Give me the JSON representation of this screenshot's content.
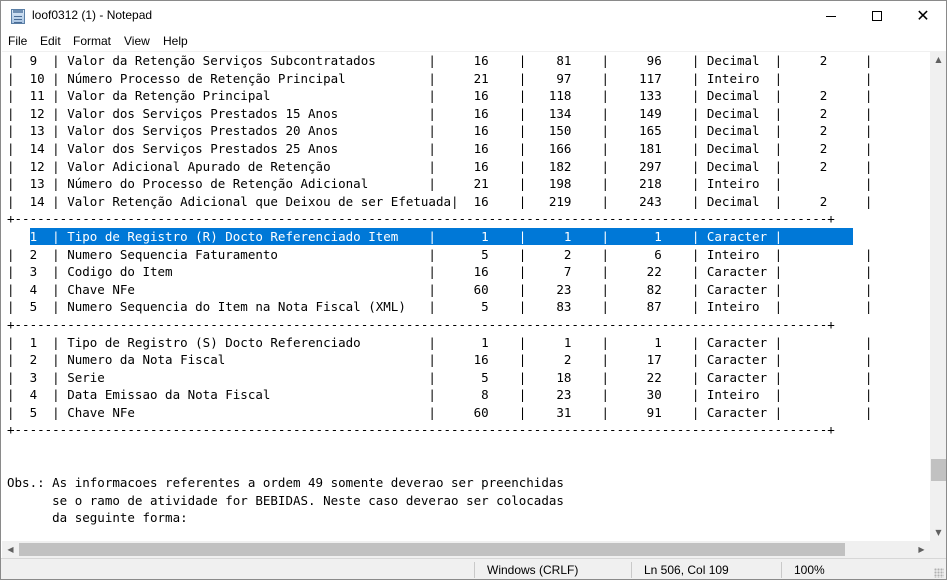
{
  "window": {
    "title": "loof0312 (1) - Notepad",
    "icon": "notepad-icon",
    "controls": {
      "minimize": "minimize-icon",
      "maximize": "maximize-icon",
      "close": "✕"
    }
  },
  "menu": {
    "items": [
      "File",
      "Edit",
      "Format",
      "View",
      "Help"
    ]
  },
  "editor": {
    "selected_line_index": 10,
    "lines": [
      "|  9  | Valor da Retenção Serviços Subcontratados       |     16    |    81    |     96    | Decimal  |     2     |",
      "|  10 | Número Processo de Retenção Principal           |     21    |    97    |    117    | Inteiro  |           |",
      "|  11 | Valor da Retenção Principal                     |     16    |   118    |    133    | Decimal  |     2     |",
      "|  12 | Valor dos Serviços Prestados 15 Anos            |     16    |   134    |    149    | Decimal  |     2     |",
      "|  13 | Valor dos Serviços Prestados 20 Anos            |     16    |   150    |    165    | Decimal  |     2     |",
      "|  14 | Valor dos Serviços Prestados 25 Anos            |     16    |   166    |    181    | Decimal  |     2     |",
      "|  12 | Valor Adicional Apurado de Retenção             |     16    |   182    |    297    | Decimal  |     2     |",
      "|  13 | Número do Processo de Retenção Adicional        |     21    |   198    |    218    | Inteiro  |           |",
      "|  14 | Valor Retenção Adicional que Deixou de ser Efetuada|  16    |   219    |    243    | Decimal  |     2     |",
      "+------------------------------------------------------------------------------------------------------------+",
      "|  1  | Tipo de Registro (R) Docto Referenciado Item    |      1    |     1    |      1    | Caracter |",
      "|  2  | Numero Sequencia Faturamento                    |      5    |     2    |      6    | Inteiro  |           |",
      "|  3  | Codigo do Item                                  |     16    |     7    |     22    | Caracter |           |",
      "|  4  | Chave NFe                                       |     60    |    23    |     82    | Caracter |           |",
      "|  5  | Numero Sequencia do Item na Nota Fiscal (XML)   |      5    |    83    |     87    | Inteiro  |           |",
      "+------------------------------------------------------------------------------------------------------------+",
      "|  1  | Tipo de Registro (S) Docto Referenciado         |      1    |     1    |      1    | Caracter |           |",
      "|  2  | Numero da Nota Fiscal                           |     16    |     2    |     17    | Caracter |           |",
      "|  3  | Serie                                           |      5    |    18    |     22    | Caracter |           |",
      "|  4  | Data Emissao da Nota Fiscal                     |      8    |    23    |     30    | Inteiro  |           |",
      "|  5  | Chave NFe                                       |     60    |    31    |     91    | Caracter |           |",
      "+------------------------------------------------------------------------------------------------------------+",
      "",
      "",
      "Obs.: As informacoes referentes a ordem 49 somente deverao ser preenchidas",
      "      se o ramo de atividade for BEBIDAS. Neste caso deverao ser colocadas",
      "      da seguinte forma:"
    ]
  },
  "statusbar": {
    "line_ending": "Windows (CRLF)",
    "position": "Ln 506, Col 109",
    "zoom": "100%"
  }
}
